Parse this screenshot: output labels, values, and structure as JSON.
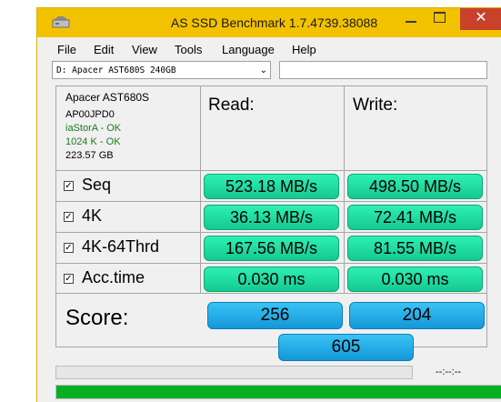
{
  "window": {
    "title": "AS SSD Benchmark 1.7.4739.38088",
    "close_glyph": "✕"
  },
  "menu": [
    "File",
    "Edit",
    "View",
    "Tools",
    "Language",
    "Help"
  ],
  "drive_select": {
    "value": "D: Apacer AST680S 240GB"
  },
  "drive_info": {
    "model": "Apacer AST680S",
    "firmware": "AP00JPD0",
    "driver_status": "iaStorA - OK",
    "alignment_status": "1024 K - OK",
    "capacity": "223.57 GB"
  },
  "columns": {
    "read": "Read:",
    "write": "Write:"
  },
  "tests": [
    {
      "label": "Seq",
      "checked": true,
      "read": "523.18 MB/s",
      "write": "498.50 MB/s"
    },
    {
      "label": "4K",
      "checked": true,
      "read": "36.13 MB/s",
      "write": "72.41 MB/s"
    },
    {
      "label": "4K-64Thrd",
      "checked": true,
      "read": "167.56 MB/s",
      "write": "81.55 MB/s"
    },
    {
      "label": "Acc.time",
      "checked": true,
      "read": "0.030 ms",
      "write": "0.030 ms"
    }
  ],
  "score": {
    "label": "Score:",
    "read": "256",
    "write": "204",
    "total": "605"
  },
  "status": {
    "time": "--:--:--",
    "top_progress": 0,
    "bottom_progress": 1.0
  },
  "colors": {
    "title_bar": "#f2c200",
    "result_green": "#1ddba0",
    "score_blue": "#27acea",
    "progress_green": "#06b025",
    "close_red": "#c7412b"
  },
  "icons": {
    "check": "✓",
    "chevron": "⌄"
  }
}
